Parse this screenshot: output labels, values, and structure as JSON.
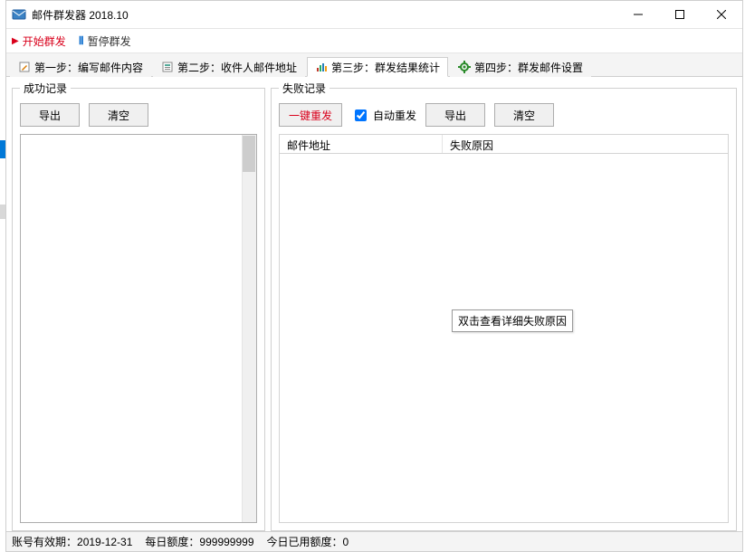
{
  "titlebar": {
    "title": "邮件群发器 2018.10"
  },
  "cmdbar": {
    "start": "开始群发",
    "pause": "暂停群发"
  },
  "steps": {
    "s1": "第一步：编写邮件内容",
    "s2": "第二步：收件人邮件地址",
    "s3": "第三步：群发结果统计",
    "s4": "第四步：群发邮件设置"
  },
  "left_panel": {
    "legend": "成功记录",
    "export": "导出",
    "clear": "清空"
  },
  "right_panel": {
    "legend": "失败记录",
    "resend": "一键重发",
    "auto_resend": "自动重发",
    "export": "导出",
    "clear": "清空",
    "col_addr": "邮件地址",
    "col_reason": "失败原因",
    "tooltip": "双击查看详细失败原因"
  },
  "status": {
    "expire_label": "账号有效期：",
    "expire_value": "2019-12-31",
    "daily_label": "每日额度：",
    "daily_value": "999999999",
    "used_label": "今日已用额度：",
    "used_value": "0"
  }
}
